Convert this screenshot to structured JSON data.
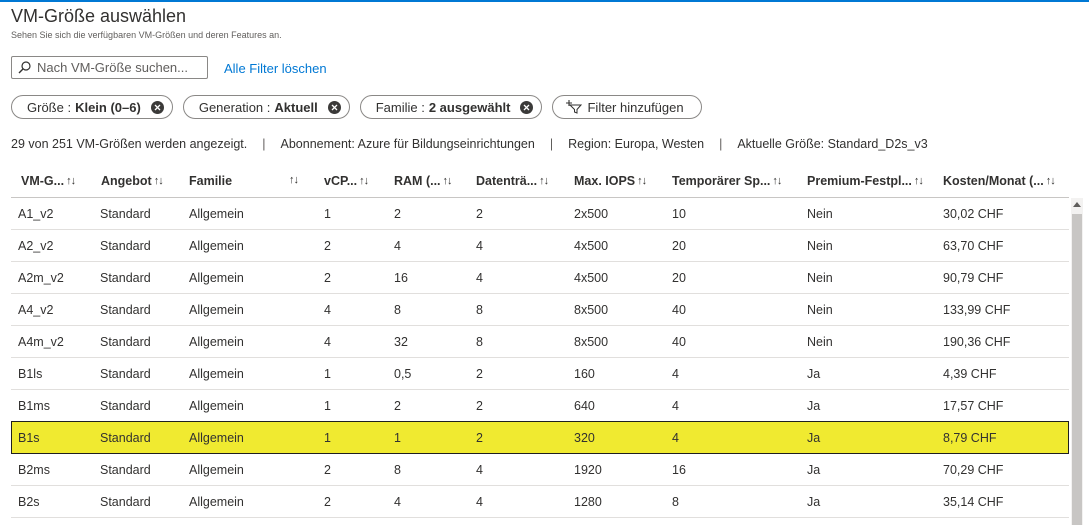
{
  "header": {
    "title": "VM-Größe auswählen",
    "subtitle": "Sehen Sie sich die verfügbaren VM-Größen und deren Features an."
  },
  "search": {
    "placeholder": "Nach VM-Größe suchen..."
  },
  "clear_filters_label": "Alle Filter löschen",
  "filters": [
    {
      "label": "Größe :",
      "value": "Klein (0–6)"
    },
    {
      "label": "Generation :",
      "value": "Aktuell"
    },
    {
      "label": "Familie :",
      "value": "2 ausgewählt"
    }
  ],
  "add_filter_label": "Filter hinzufügen",
  "info": {
    "count": "29 von 251 VM-Größen werden angezeigt.",
    "subscription": "Abonnement: Azure für Bildungseinrichtungen",
    "region": "Region: Europa, Westen",
    "current_size": "Aktuelle Größe: Standard_D2s_v3",
    "separator": "|"
  },
  "sort_glyph": "↑↓",
  "columns": [
    "VM-G...",
    "Angebot",
    "Familie",
    "",
    "vCP...",
    "RAM (...",
    "Datenträ...",
    "Max. IOPS",
    "Temporärer Sp...",
    "Premium-Festpl...",
    "Kosten/Monat (..."
  ],
  "rows": [
    {
      "name": "A1_v2",
      "offer": "Standard",
      "family": "Allgemein",
      "vcpu": "1",
      "ram": "2",
      "disks": "2",
      "iops": "2x500",
      "temp": "10",
      "premium": "Nein",
      "cost": "30,02 CHF",
      "selected": false
    },
    {
      "name": "A2_v2",
      "offer": "Standard",
      "family": "Allgemein",
      "vcpu": "2",
      "ram": "4",
      "disks": "4",
      "iops": "4x500",
      "temp": "20",
      "premium": "Nein",
      "cost": "63,70 CHF",
      "selected": false
    },
    {
      "name": "A2m_v2",
      "offer": "Standard",
      "family": "Allgemein",
      "vcpu": "2",
      "ram": "16",
      "disks": "4",
      "iops": "4x500",
      "temp": "20",
      "premium": "Nein",
      "cost": "90,79 CHF",
      "selected": false
    },
    {
      "name": "A4_v2",
      "offer": "Standard",
      "family": "Allgemein",
      "vcpu": "4",
      "ram": "8",
      "disks": "8",
      "iops": "8x500",
      "temp": "40",
      "premium": "Nein",
      "cost": "133,99 CHF",
      "selected": false
    },
    {
      "name": "A4m_v2",
      "offer": "Standard",
      "family": "Allgemein",
      "vcpu": "4",
      "ram": "32",
      "disks": "8",
      "iops": "8x500",
      "temp": "40",
      "premium": "Nein",
      "cost": "190,36 CHF",
      "selected": false
    },
    {
      "name": "B1ls",
      "offer": "Standard",
      "family": "Allgemein",
      "vcpu": "1",
      "ram": "0,5",
      "disks": "2",
      "iops": "160",
      "temp": "4",
      "premium": "Ja",
      "cost": "4,39 CHF",
      "selected": false
    },
    {
      "name": "B1ms",
      "offer": "Standard",
      "family": "Allgemein",
      "vcpu": "1",
      "ram": "2",
      "disks": "2",
      "iops": "640",
      "temp": "4",
      "premium": "Ja",
      "cost": "17,57 CHF",
      "selected": false
    },
    {
      "name": "B1s",
      "offer": "Standard",
      "family": "Allgemein",
      "vcpu": "1",
      "ram": "1",
      "disks": "2",
      "iops": "320",
      "temp": "4",
      "premium": "Ja",
      "cost": "8,79 CHF",
      "selected": true
    },
    {
      "name": "B2ms",
      "offer": "Standard",
      "family": "Allgemein",
      "vcpu": "2",
      "ram": "8",
      "disks": "4",
      "iops": "1920",
      "temp": "16",
      "premium": "Ja",
      "cost": "70,29 CHF",
      "selected": false
    },
    {
      "name": "B2s",
      "offer": "Standard",
      "family": "Allgemein",
      "vcpu": "2",
      "ram": "4",
      "disks": "4",
      "iops": "1280",
      "temp": "8",
      "premium": "Ja",
      "cost": "35,14 CHF",
      "selected": false
    }
  ],
  "colors": {
    "accent": "#0078d4",
    "selected_row": "#f0ea30"
  }
}
